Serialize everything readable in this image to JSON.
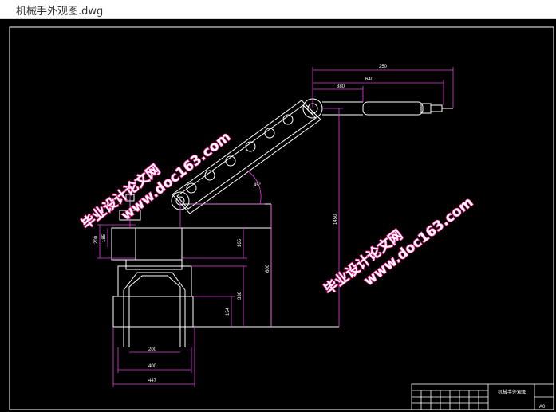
{
  "window": {
    "title": "机械手外观图.dwg"
  },
  "drawing": {
    "dimensions": {
      "top_overall": "250",
      "top_mid": "640",
      "top_short": "380",
      "vertical_right": "1450",
      "vertical_mid": "600",
      "vertical_col": "336",
      "vertical_base": "154",
      "vertical_arm": "165",
      "left_a": "200",
      "left_b": "185",
      "bottom_inner": "200",
      "bottom_mid": "400",
      "bottom_outer": "447",
      "angle": "45°"
    },
    "watermarks": [
      {
        "line1": "毕业设计论文网",
        "line2": "www.doc163.com"
      },
      {
        "line1": "毕业设计论文网",
        "line2": "www.doc163.com"
      }
    ],
    "title_block": {
      "name": "机械手外观图",
      "sheet": "A0"
    }
  }
}
